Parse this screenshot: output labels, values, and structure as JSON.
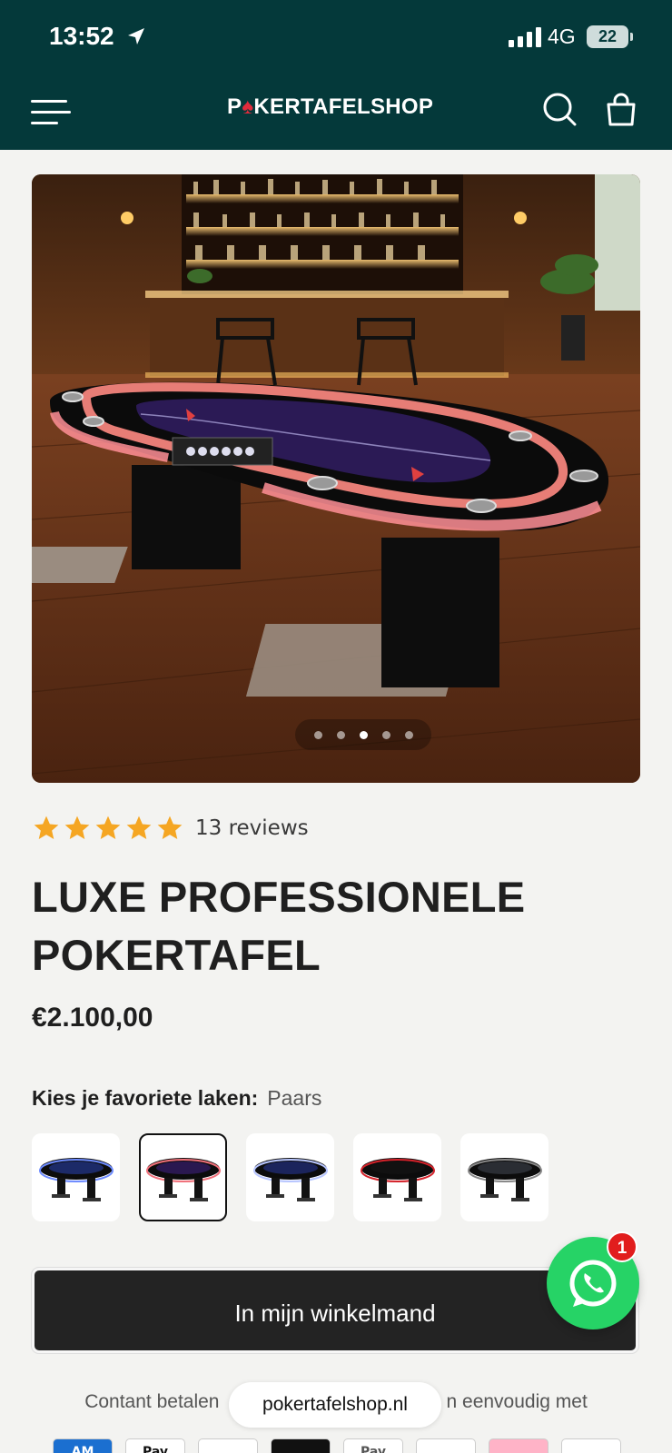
{
  "status_bar": {
    "time": "13:52",
    "network": "4G",
    "battery": "22"
  },
  "header": {
    "logo": "POKERTAFELSHOP",
    "logo_parts": {
      "before": "P",
      "spade": "♠",
      "after": "KERTAFELSHOP"
    }
  },
  "gallery": {
    "total_images": 5,
    "active_index": 2
  },
  "rating": {
    "stars": 5,
    "reviews_text": "13 reviews"
  },
  "product": {
    "title": "LUXE PROFESSIONELE POKERTAFEL",
    "price": "€2.100,00",
    "option_label": "Kies je favoriete laken:",
    "option_value": "Paars",
    "swatches": [
      {
        "name": "blauw",
        "felt": "#1c2a68",
        "rail": "#6d8bff"
      },
      {
        "name": "paars",
        "felt": "#2a1850",
        "rail": "#f0707a"
      },
      {
        "name": "blauw-wit",
        "felt": "#1b245c",
        "rail": "#b8c6ff"
      },
      {
        "name": "rood",
        "felt": "#111",
        "rail": "#d4222a"
      },
      {
        "name": "zwart",
        "felt": "#2a2d33",
        "rail": "#888"
      }
    ],
    "selected_swatch": 1
  },
  "cart_button": "In mijn winkelmand",
  "whatsapp_badge": "1",
  "payment": {
    "text_left": "Contant betalen",
    "text_right": "n eenvoudig met",
    "icons": [
      {
        "name": "amex",
        "label": "AM",
        "bg": "#1b6fd0",
        "fg": "#fff"
      },
      {
        "name": "apple-pay",
        "label": "Pay",
        "bg": "#fff",
        "fg": "#111"
      },
      {
        "name": "bancontact",
        "label": "",
        "bg": "#fff",
        "fg": "#f5b800"
      },
      {
        "name": "ideal-dark",
        "label": "",
        "bg": "#111",
        "fg": "#fff"
      },
      {
        "name": "google-pay",
        "label": "Pay",
        "bg": "#fff",
        "fg": "#555"
      },
      {
        "name": "klarna",
        "label": "",
        "bg": "#fff",
        "fg": "#333"
      },
      {
        "name": "klarna-pink",
        "label": "",
        "bg": "#ffb3c7",
        "fg": "#000"
      },
      {
        "name": "maestro",
        "label": "",
        "bg": "#fff",
        "fg": "#e11"
      }
    ]
  },
  "url": "pokertafelshop.nl",
  "colors": {
    "brand": "#04393a",
    "star": "#f5a623",
    "cta": "#232323",
    "whatsapp": "#26d366"
  }
}
